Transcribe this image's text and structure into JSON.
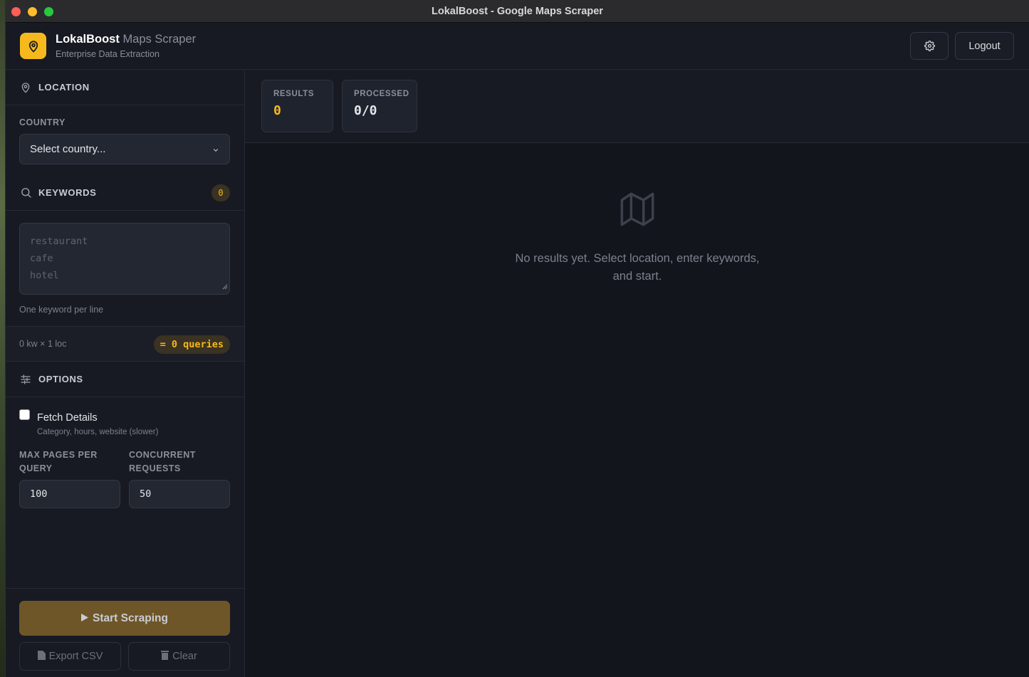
{
  "window": {
    "title": "LokalBoost - Google Maps Scraper"
  },
  "header": {
    "brand_name": "LokalBoost",
    "brand_suffix": "Maps Scraper",
    "tagline": "Enterprise Data Extraction",
    "logout_label": "Logout",
    "accent_color": "#f5b91d"
  },
  "sidebar": {
    "location": {
      "title": "LOCATION",
      "country_label": "COUNTRY",
      "country_value": "Select country..."
    },
    "keywords": {
      "title": "KEYWORDS",
      "count": "0",
      "placeholder_lines": [
        "restaurant",
        "cafe",
        "hotel"
      ],
      "hint": "One keyword per line",
      "summary": "0 kw × 1 loc",
      "queries": "= 0 queries"
    },
    "options": {
      "title": "OPTIONS",
      "fetch_details_label": "Fetch Details",
      "fetch_details_desc": "Category, hours, website (slower)",
      "fetch_details_checked": false,
      "max_pages_label_line1": "MAX PAGES PER",
      "max_pages_label_line2": "QUERY",
      "max_pages_value": "100",
      "concurrent_label_line1": "CONCURRENT",
      "concurrent_label_line2": "REQUESTS",
      "concurrent_value": "50"
    },
    "actions": {
      "start_label": "Start Scraping",
      "export_label": "Export CSV",
      "clear_label": "Clear"
    }
  },
  "main": {
    "stats": [
      {
        "label": "RESULTS",
        "value": "0",
        "color": "#f5b91d"
      },
      {
        "label": "PROCESSED",
        "value": "0/0",
        "color": "#e4e6ea"
      }
    ],
    "empty_line1": "No results yet. Select location, enter keywords,",
    "empty_line2": "and start."
  }
}
